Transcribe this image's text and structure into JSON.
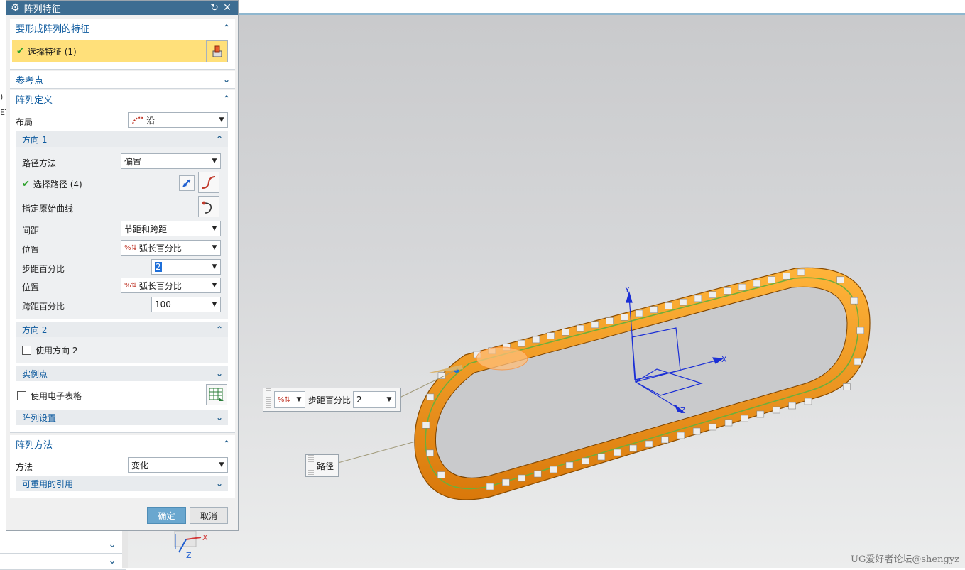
{
  "dialog": {
    "title": "阵列特征",
    "features_group": {
      "label": "要形成阵列的特征",
      "select_label": "选择特征 (1)"
    },
    "ref_point_group": {
      "label": "参考点"
    },
    "pattern_def_group": {
      "label": "阵列定义",
      "layout_label": "布局",
      "layout_value": "沿"
    },
    "direction1": {
      "label": "方向 1",
      "path_method_label": "路径方法",
      "path_method_value": "偏置",
      "select_path_label": "选择路径 (4)",
      "orig_curve_label": "指定原始曲线",
      "spacing_label": "间距",
      "spacing_value": "节距和跨距",
      "position1_label": "位置",
      "position1_value": "弧长百分比",
      "pitch_pct_label": "步距百分比",
      "pitch_pct_value": "2",
      "position2_label": "位置",
      "position2_value": "弧长百分比",
      "span_pct_label": "跨距百分比",
      "span_pct_value": "100"
    },
    "direction2": {
      "label": "方向 2",
      "use_dir2_label": "使用方向 2"
    },
    "instance_points": {
      "label": "实例点"
    },
    "spreadsheet_label": "使用电子表格",
    "pattern_settings": {
      "label": "阵列设置"
    },
    "pattern_method_group": {
      "label": "阵列方法",
      "method_label": "方法",
      "method_value": "变化"
    },
    "reusable_refs": {
      "label": "可重用的引用"
    },
    "ok_label": "确定",
    "cancel_label": "取消"
  },
  "viewport": {
    "float_pitch_label": "步距百分比",
    "float_pitch_value": "2",
    "float_path_label": "路径",
    "csys_axes": [
      "X",
      "Y",
      "Z"
    ],
    "mini_axes": [
      "X",
      "Z"
    ],
    "watermark": "UG爱好者论坛@shengyz",
    "edge_text": [
      ")",
      "ET"
    ]
  },
  "colors": {
    "accent": "#3d6d92",
    "group_header": "#0d5a9e",
    "highlight": "#ffe07a",
    "chain": "#f39a12",
    "ok": "#6aa7cf"
  }
}
